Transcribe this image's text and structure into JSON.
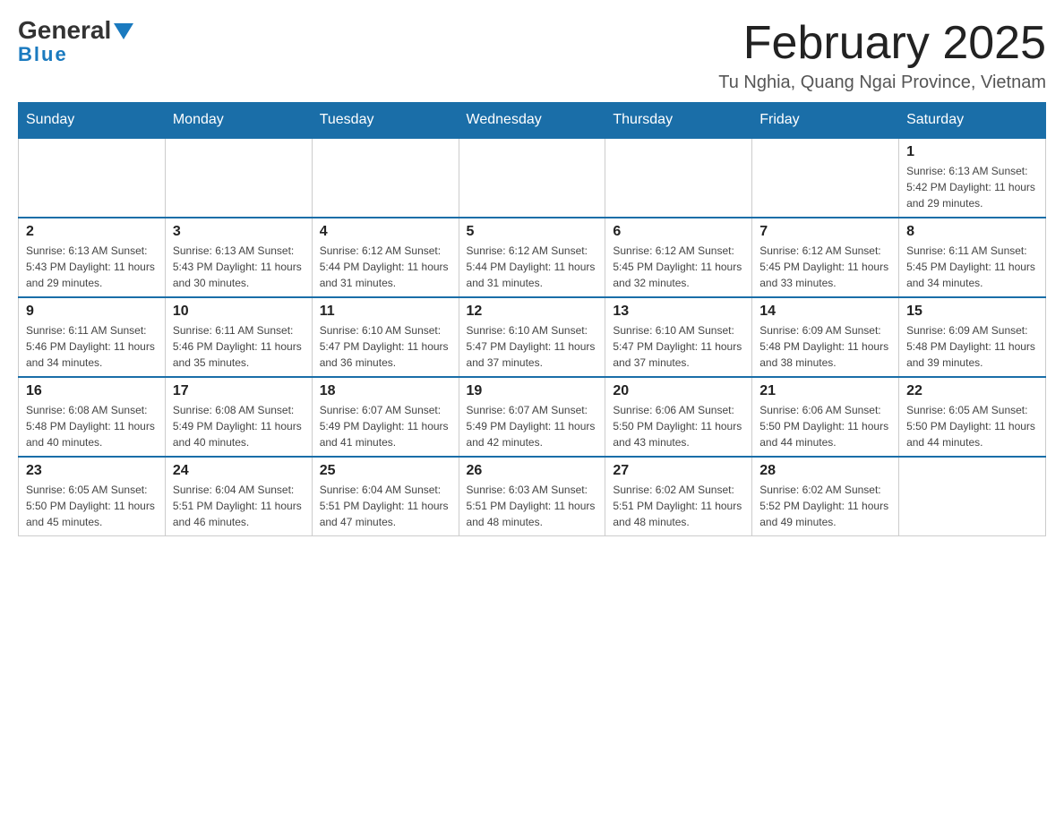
{
  "header": {
    "logo": {
      "part1": "General",
      "part2": "Blue"
    },
    "title": "February 2025",
    "location": "Tu Nghia, Quang Ngai Province, Vietnam"
  },
  "calendar": {
    "days_of_week": [
      "Sunday",
      "Monday",
      "Tuesday",
      "Wednesday",
      "Thursday",
      "Friday",
      "Saturday"
    ],
    "weeks": [
      [
        {
          "day": "",
          "info": ""
        },
        {
          "day": "",
          "info": ""
        },
        {
          "day": "",
          "info": ""
        },
        {
          "day": "",
          "info": ""
        },
        {
          "day": "",
          "info": ""
        },
        {
          "day": "",
          "info": ""
        },
        {
          "day": "1",
          "info": "Sunrise: 6:13 AM\nSunset: 5:42 PM\nDaylight: 11 hours and 29 minutes."
        }
      ],
      [
        {
          "day": "2",
          "info": "Sunrise: 6:13 AM\nSunset: 5:43 PM\nDaylight: 11 hours and 29 minutes."
        },
        {
          "day": "3",
          "info": "Sunrise: 6:13 AM\nSunset: 5:43 PM\nDaylight: 11 hours and 30 minutes."
        },
        {
          "day": "4",
          "info": "Sunrise: 6:12 AM\nSunset: 5:44 PM\nDaylight: 11 hours and 31 minutes."
        },
        {
          "day": "5",
          "info": "Sunrise: 6:12 AM\nSunset: 5:44 PM\nDaylight: 11 hours and 31 minutes."
        },
        {
          "day": "6",
          "info": "Sunrise: 6:12 AM\nSunset: 5:45 PM\nDaylight: 11 hours and 32 minutes."
        },
        {
          "day": "7",
          "info": "Sunrise: 6:12 AM\nSunset: 5:45 PM\nDaylight: 11 hours and 33 minutes."
        },
        {
          "day": "8",
          "info": "Sunrise: 6:11 AM\nSunset: 5:45 PM\nDaylight: 11 hours and 34 minutes."
        }
      ],
      [
        {
          "day": "9",
          "info": "Sunrise: 6:11 AM\nSunset: 5:46 PM\nDaylight: 11 hours and 34 minutes."
        },
        {
          "day": "10",
          "info": "Sunrise: 6:11 AM\nSunset: 5:46 PM\nDaylight: 11 hours and 35 minutes."
        },
        {
          "day": "11",
          "info": "Sunrise: 6:10 AM\nSunset: 5:47 PM\nDaylight: 11 hours and 36 minutes."
        },
        {
          "day": "12",
          "info": "Sunrise: 6:10 AM\nSunset: 5:47 PM\nDaylight: 11 hours and 37 minutes."
        },
        {
          "day": "13",
          "info": "Sunrise: 6:10 AM\nSunset: 5:47 PM\nDaylight: 11 hours and 37 minutes."
        },
        {
          "day": "14",
          "info": "Sunrise: 6:09 AM\nSunset: 5:48 PM\nDaylight: 11 hours and 38 minutes."
        },
        {
          "day": "15",
          "info": "Sunrise: 6:09 AM\nSunset: 5:48 PM\nDaylight: 11 hours and 39 minutes."
        }
      ],
      [
        {
          "day": "16",
          "info": "Sunrise: 6:08 AM\nSunset: 5:48 PM\nDaylight: 11 hours and 40 minutes."
        },
        {
          "day": "17",
          "info": "Sunrise: 6:08 AM\nSunset: 5:49 PM\nDaylight: 11 hours and 40 minutes."
        },
        {
          "day": "18",
          "info": "Sunrise: 6:07 AM\nSunset: 5:49 PM\nDaylight: 11 hours and 41 minutes."
        },
        {
          "day": "19",
          "info": "Sunrise: 6:07 AM\nSunset: 5:49 PM\nDaylight: 11 hours and 42 minutes."
        },
        {
          "day": "20",
          "info": "Sunrise: 6:06 AM\nSunset: 5:50 PM\nDaylight: 11 hours and 43 minutes."
        },
        {
          "day": "21",
          "info": "Sunrise: 6:06 AM\nSunset: 5:50 PM\nDaylight: 11 hours and 44 minutes."
        },
        {
          "day": "22",
          "info": "Sunrise: 6:05 AM\nSunset: 5:50 PM\nDaylight: 11 hours and 44 minutes."
        }
      ],
      [
        {
          "day": "23",
          "info": "Sunrise: 6:05 AM\nSunset: 5:50 PM\nDaylight: 11 hours and 45 minutes."
        },
        {
          "day": "24",
          "info": "Sunrise: 6:04 AM\nSunset: 5:51 PM\nDaylight: 11 hours and 46 minutes."
        },
        {
          "day": "25",
          "info": "Sunrise: 6:04 AM\nSunset: 5:51 PM\nDaylight: 11 hours and 47 minutes."
        },
        {
          "day": "26",
          "info": "Sunrise: 6:03 AM\nSunset: 5:51 PM\nDaylight: 11 hours and 48 minutes."
        },
        {
          "day": "27",
          "info": "Sunrise: 6:02 AM\nSunset: 5:51 PM\nDaylight: 11 hours and 48 minutes."
        },
        {
          "day": "28",
          "info": "Sunrise: 6:02 AM\nSunset: 5:52 PM\nDaylight: 11 hours and 49 minutes."
        },
        {
          "day": "",
          "info": ""
        }
      ]
    ]
  }
}
